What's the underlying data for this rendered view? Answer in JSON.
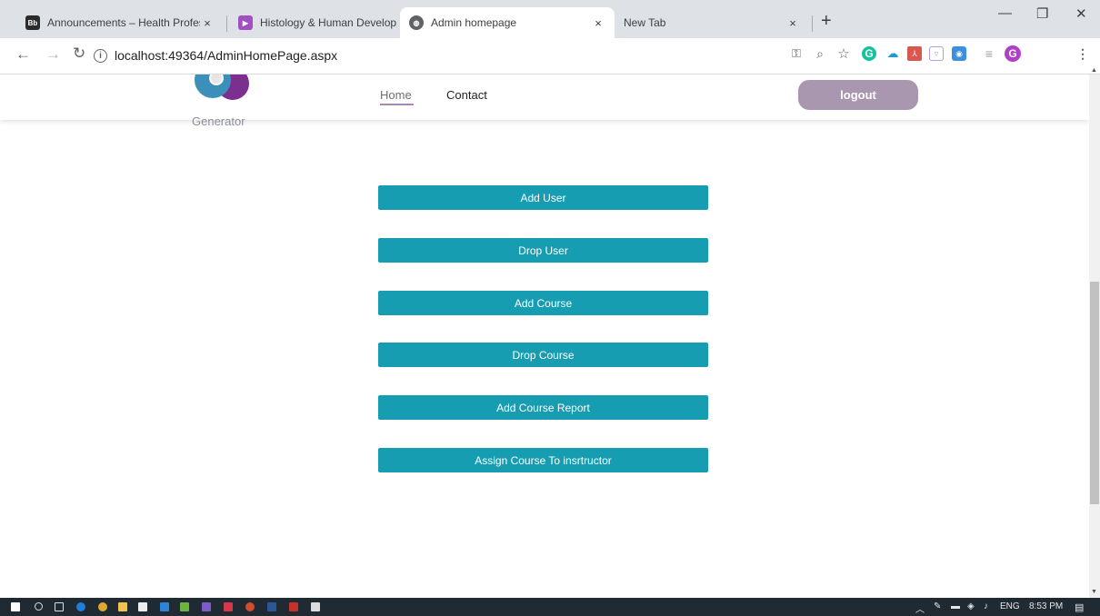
{
  "browser": {
    "tabs": [
      {
        "title": "Announcements – Health Profess",
        "favicon": "Bb",
        "active": false
      },
      {
        "title": "Histology & Human Developmen",
        "favicon": "",
        "active": false
      },
      {
        "title": "Admin homepage",
        "favicon": "",
        "active": true
      },
      {
        "title": "New Tab",
        "favicon": "",
        "active": false
      }
    ],
    "new_tab_label": "+",
    "close_glyph": "×",
    "address": "localhost:49364/AdminHomePage.aspx",
    "profile_initial": "G"
  },
  "site": {
    "logo_text": "Generator",
    "nav": {
      "home": "Home",
      "contact": "Contact"
    },
    "logout_label": "logout"
  },
  "actions": [
    {
      "label": "Add User"
    },
    {
      "label": "Drop User"
    },
    {
      "label": "Add Course"
    },
    {
      "label": "Drop Course"
    },
    {
      "label": "Add Course Report"
    },
    {
      "label": "Assign Course To insrtructor"
    }
  ],
  "taskbar": {
    "language": "ENG",
    "clock": "8:53 PM"
  },
  "colors": {
    "action_button": "#179db1",
    "logout_button": "#a997b0",
    "nav_underline": "#a988b0"
  }
}
